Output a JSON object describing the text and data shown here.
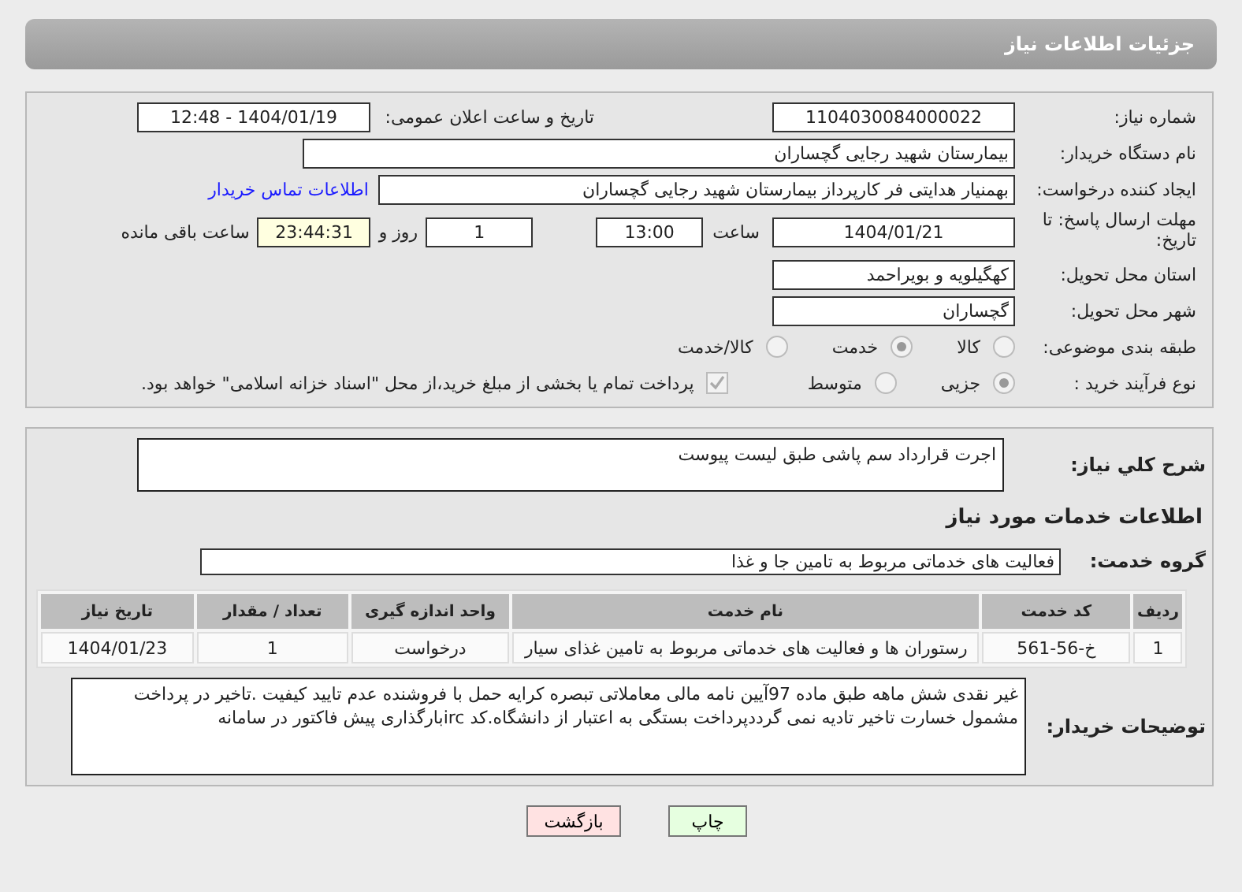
{
  "header": {
    "title": "جزئیات اطلاعات نیاز"
  },
  "need_number": {
    "label": "شماره نیاز:",
    "value": "1104030084000022"
  },
  "announce": {
    "label": "تاریخ و ساعت اعلان عمومی:",
    "value": "1404/01/19 - 12:48"
  },
  "buyer_org": {
    "label": "نام دستگاه خریدار:",
    "value": "بیمارستان شهید رجایی گچساران"
  },
  "requester": {
    "label": "ایجاد کننده درخواست:",
    "value": "بهمنیار هدایتی فر کارپرداز بیمارستان شهید رجایی گچساران",
    "link": "اطلاعات تماس خریدار"
  },
  "deadline": {
    "label": "مهلت ارسال پاسخ: تا تاریخ:",
    "date": "1404/01/21",
    "time_label": "ساعت",
    "time": "13:00",
    "days": "1",
    "days_label": "روز و",
    "remaining": "23:44:31",
    "remaining_label": "ساعت باقی مانده"
  },
  "province": {
    "label": "استان محل تحویل:",
    "value": "کهگیلویه و بویراحمد"
  },
  "city": {
    "label": "شهر محل تحویل:",
    "value": "گچساران"
  },
  "category": {
    "label": "طبقه بندی موضوعی:",
    "options": [
      {
        "label": "کالا",
        "selected": false
      },
      {
        "label": "خدمت",
        "selected": true
      },
      {
        "label": "کالا/خدمت",
        "selected": false
      }
    ]
  },
  "process": {
    "label": "نوع فرآیند خرید :",
    "options": [
      {
        "label": "جزیی",
        "selected": true
      },
      {
        "label": "متوسط",
        "selected": false
      }
    ],
    "payment": {
      "checked": true,
      "text": "پرداخت تمام یا بخشی از مبلغ خرید،از محل \"اسناد خزانه اسلامی\" خواهد بود."
    }
  },
  "description": {
    "label": "شرح کلي نياز:",
    "value": "اجرت قرارداد سم پاشی طبق لیست پیوست"
  },
  "services_heading": "اطلاعات خدمات مورد نیاز",
  "service_group": {
    "label": "گروه خدمت:",
    "value": "فعالیت های خدماتی مربوط به تامین جا و غذا"
  },
  "table": {
    "columns": [
      "ردیف",
      "کد خدمت",
      "نام خدمت",
      "واحد اندازه گیری",
      "تعداد / مقدار",
      "تاریخ نیاز"
    ],
    "rows": [
      [
        "1",
        "خ-56-561",
        "رستوران ها و فعالیت های خدماتی مربوط به تامین غذای سیار",
        "درخواست",
        "1",
        "1404/01/23"
      ]
    ]
  },
  "buyer_notes": {
    "label": "توضیحات خریدار:",
    "value": "غیر نقدی شش ماهه طبق ماده 97آیین نامه مالی معاملاتی تبصره کرایه حمل با فروشنده عدم تایید کیفیت .تاخیر در پرداخت مشمول خسارت تاخیر تادیه نمی گرددپرداخت بستگی به اعتبار از دانشگاه.کد ircبارگذاری پیش فاکتور در سامانه"
  },
  "buttons": [
    {
      "label": "چاپ",
      "kind": "print"
    },
    {
      "label": "بازگشت",
      "kind": "back"
    }
  ]
}
